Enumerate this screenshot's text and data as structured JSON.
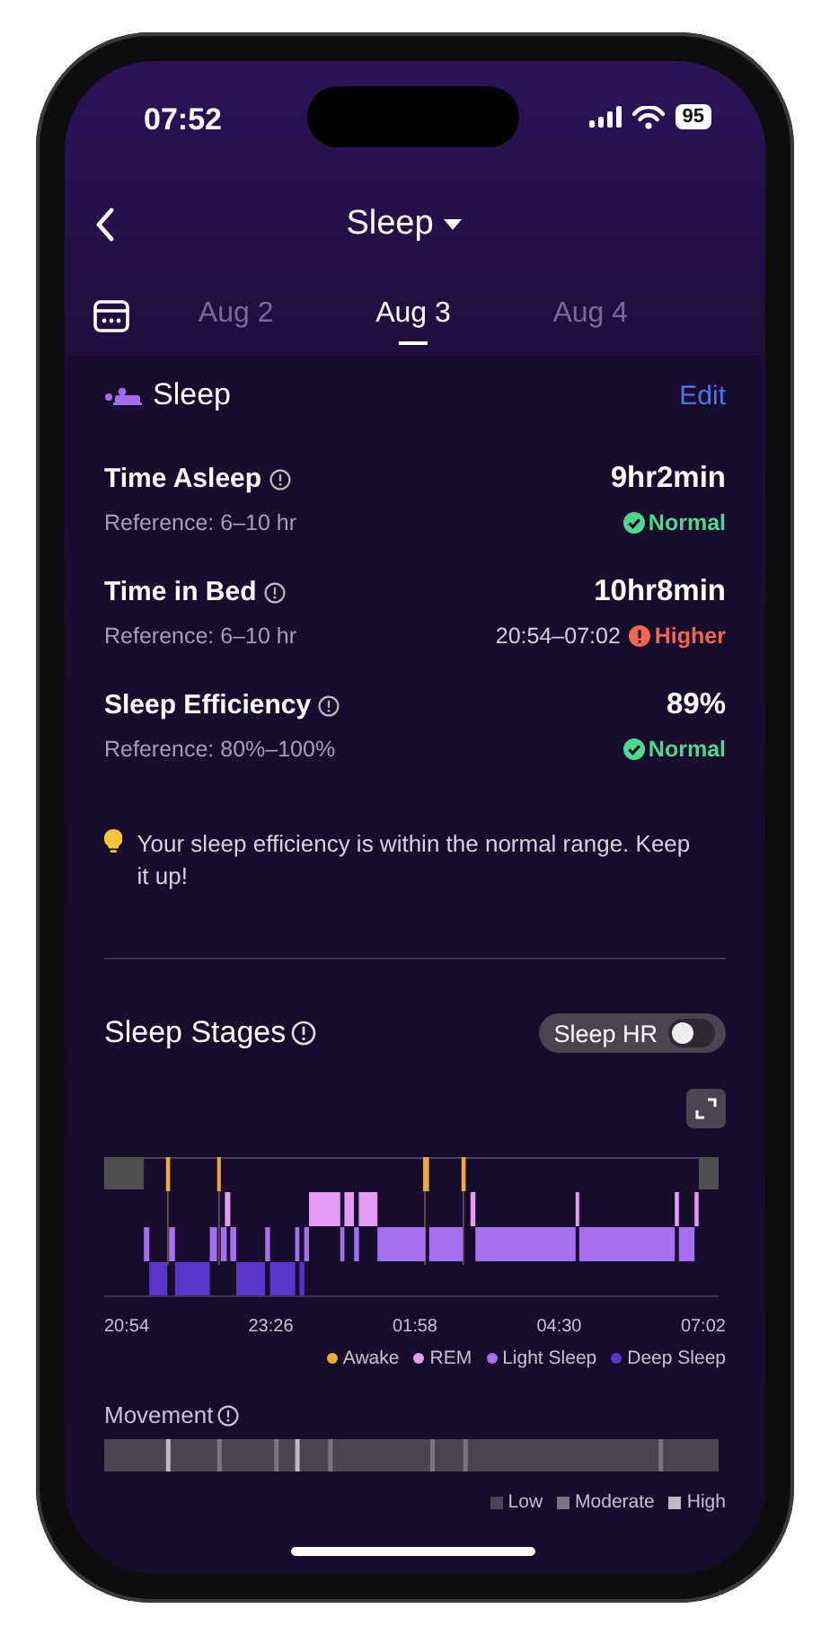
{
  "status_bar": {
    "time": "07:52",
    "battery": "95"
  },
  "header": {
    "title": "Sleep"
  },
  "date_tabs": [
    {
      "label": "Aug 2",
      "selected": false
    },
    {
      "label": "Aug 3",
      "selected": true
    },
    {
      "label": "Aug 4",
      "selected": false
    }
  ],
  "summary": {
    "title": "Sleep",
    "edit": "Edit",
    "metrics": [
      {
        "label": "Time Asleep",
        "value": "9hr2min",
        "reference": "Reference: 6–10 hr",
        "status": "Normal",
        "kind": "normal"
      },
      {
        "label": "Time in Bed",
        "value": "10hr8min",
        "reference": "Reference: 6–10 hr",
        "range": "20:54–07:02",
        "status": "Higher",
        "kind": "high"
      },
      {
        "label": "Sleep Efficiency",
        "value": "89%",
        "reference": "Reference: 80%–100%",
        "status": "Normal",
        "kind": "normal"
      }
    ],
    "tip": "Your sleep efficiency is within the normal range. Keep it up!"
  },
  "stages": {
    "title": "Sleep Stages",
    "toggle": {
      "label": "Sleep HR",
      "on": false
    },
    "axis_labels": [
      "20:54",
      "23:26",
      "01:58",
      "04:30",
      "07:02"
    ],
    "legend": [
      {
        "label": "Awake",
        "color": "#f2a93b"
      },
      {
        "label": "REM",
        "color": "#e39af5"
      },
      {
        "label": "Light Sleep",
        "color": "#a66ff0"
      },
      {
        "label": "Deep Sleep",
        "color": "#5a34c8"
      }
    ]
  },
  "movement": {
    "title": "Movement",
    "legend": [
      {
        "label": "Low",
        "color": "#4a4452"
      },
      {
        "label": "Moderate",
        "color": "#7a7480"
      },
      {
        "label": "High",
        "color": "#bdb8c2"
      }
    ]
  }
}
